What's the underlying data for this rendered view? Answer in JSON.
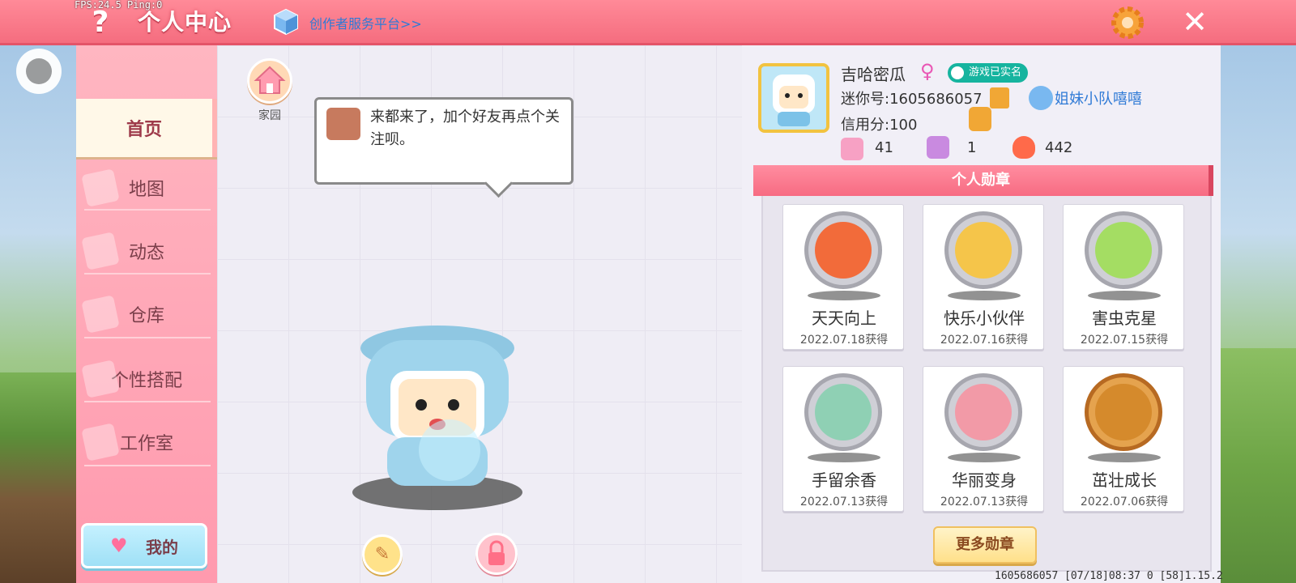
{
  "debug": {
    "fps_ping": "FPS:24.5  Ping:0"
  },
  "header": {
    "title": "个人中心",
    "help": "?",
    "creator_link": "创作者服务平台>>",
    "close": "✕"
  },
  "sidebar": {
    "items": [
      {
        "label": "首页",
        "active": true
      },
      {
        "label": "地图",
        "active": false
      },
      {
        "label": "动态",
        "active": false
      },
      {
        "label": "仓库",
        "active": false
      },
      {
        "label": "个性搭配",
        "active": false
      },
      {
        "label": "工作室",
        "active": false
      }
    ],
    "mine_label": "我的"
  },
  "home": {
    "label": "家园"
  },
  "speech": {
    "text": "来都来了，加个好友再点个关注呗。"
  },
  "profile": {
    "name": "吉哈密瓜",
    "gender_symbol": "♀",
    "verified_label": "游戏已实名",
    "mini_id": "迷你号:1605686057",
    "team_name": "姐妹小队嘻嘻",
    "credit": "信用分:100",
    "stats": [
      {
        "icon": "plus-badge-icon",
        "value": "41"
      },
      {
        "icon": "cheer-icon",
        "value": "1"
      },
      {
        "icon": "flame-icon",
        "value": "442"
      }
    ]
  },
  "medals": {
    "header": "个人勋章",
    "items": [
      {
        "name": "天天向上",
        "date": "2022.07.18获得",
        "color": "#f26b3a"
      },
      {
        "name": "快乐小伙伴",
        "date": "2022.07.16获得",
        "color": "#f5c54a"
      },
      {
        "name": "害虫克星",
        "date": "2022.07.15获得",
        "color": "#a4dd63"
      },
      {
        "name": "手留余香",
        "date": "2022.07.13获得",
        "color": "#8fd0b4"
      },
      {
        "name": "华丽变身",
        "date": "2022.07.13获得",
        "color": "#f29aa7"
      },
      {
        "name": "茁壮成长",
        "date": "2022.07.06获得",
        "color": "#d58a2c"
      }
    ],
    "more_label": "更多勋章"
  },
  "footer": {
    "info": "1605686057    [07/18]08:37 0   [58]1.15.2"
  }
}
